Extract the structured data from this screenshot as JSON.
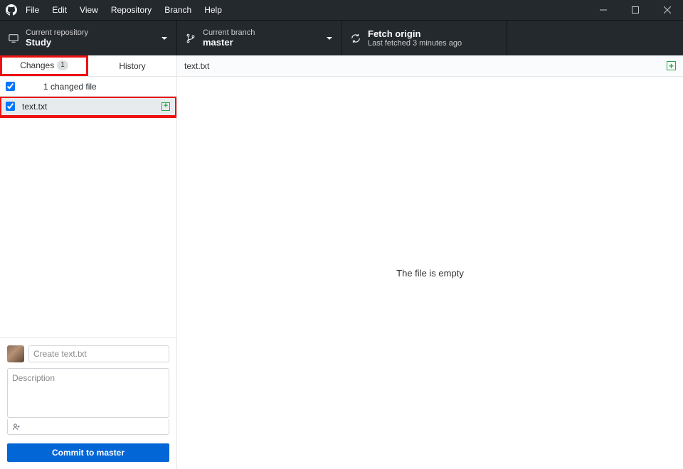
{
  "menu": {
    "file": "File",
    "edit": "Edit",
    "view": "View",
    "repository": "Repository",
    "branch": "Branch",
    "help": "Help"
  },
  "toolbar": {
    "repo": {
      "label": "Current repository",
      "value": "Study"
    },
    "branch": {
      "label": "Current branch",
      "value": "master"
    },
    "fetch": {
      "label": "Fetch origin",
      "sub": "Last fetched 3 minutes ago"
    }
  },
  "tabs": {
    "changes": "Changes",
    "changes_count": "1",
    "history": "History"
  },
  "changed": {
    "summary": "1 changed file",
    "files": [
      {
        "name": "text.txt",
        "checked": true
      }
    ]
  },
  "fileview": {
    "filename": "text.txt",
    "empty_text": "The file is empty"
  },
  "commit": {
    "summary_placeholder": "Create text.txt",
    "description_placeholder": "Description",
    "button_prefix": "Commit to ",
    "button_branch": "master"
  }
}
